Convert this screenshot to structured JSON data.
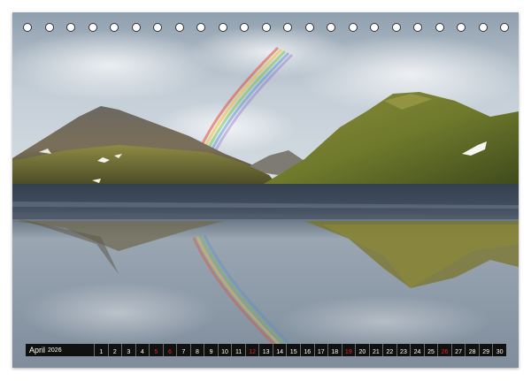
{
  "calendar": {
    "month": "April",
    "year": "2026",
    "binding_hole_count": 23,
    "days": [
      {
        "n": "1"
      },
      {
        "n": "2"
      },
      {
        "n": "3"
      },
      {
        "n": "4"
      },
      {
        "n": "5",
        "holiday": true
      },
      {
        "n": "6",
        "holiday": true
      },
      {
        "n": "7"
      },
      {
        "n": "8"
      },
      {
        "n": "9"
      },
      {
        "n": "10"
      },
      {
        "n": "11"
      },
      {
        "n": "12",
        "holiday": true
      },
      {
        "n": "13"
      },
      {
        "n": "14"
      },
      {
        "n": "15"
      },
      {
        "n": "16"
      },
      {
        "n": "17"
      },
      {
        "n": "18"
      },
      {
        "n": "19",
        "holiday": true
      },
      {
        "n": "20"
      },
      {
        "n": "21"
      },
      {
        "n": "22"
      },
      {
        "n": "23"
      },
      {
        "n": "24"
      },
      {
        "n": "25"
      },
      {
        "n": "26",
        "holiday": true
      },
      {
        "n": "27"
      },
      {
        "n": "28"
      },
      {
        "n": "29"
      },
      {
        "n": "30"
      }
    ]
  },
  "colors": {
    "strip_background": "#111111",
    "weekday_text": "#ffffff",
    "holiday_text": "#e0262a"
  }
}
